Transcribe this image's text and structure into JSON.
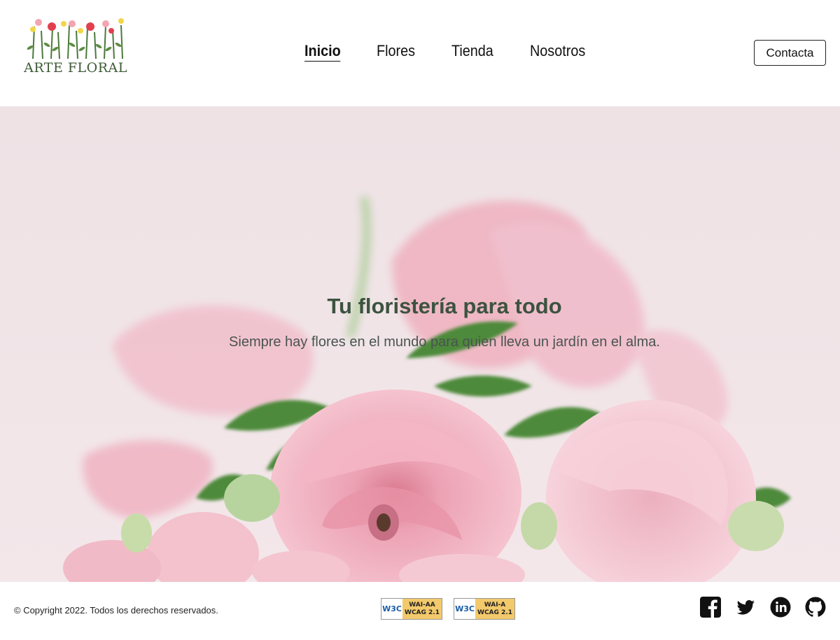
{
  "header": {
    "logo_text": "ARTE FLORAL",
    "nav": [
      {
        "label": "Inicio",
        "active": true
      },
      {
        "label": "Flores",
        "active": false
      },
      {
        "label": "Tienda",
        "active": false
      },
      {
        "label": "Nosotros",
        "active": false
      }
    ],
    "contact_label": "Contacta"
  },
  "hero": {
    "title": "Tu floristería para todo",
    "subtitle": "Siempre hay flores en el mundo para quien lleva un jardín en el alma."
  },
  "footer": {
    "copyright": "© Copyright 2022. Todos los derechos reservados.",
    "badges": [
      {
        "w3c": "W3C",
        "level": "WAI-AA",
        "standard": "WCAG 2.1"
      },
      {
        "w3c": "W3C",
        "level": "WAI-A",
        "standard": "WCAG 2.1"
      }
    ],
    "social": [
      "facebook-icon",
      "twitter-icon",
      "linkedin-icon",
      "github-icon"
    ]
  },
  "colors": {
    "title_green": "#3c5340",
    "hero_bg": "#efe3e5",
    "petal_pink": "#f0a8b8",
    "leaf_green": "#4e8a3a"
  }
}
